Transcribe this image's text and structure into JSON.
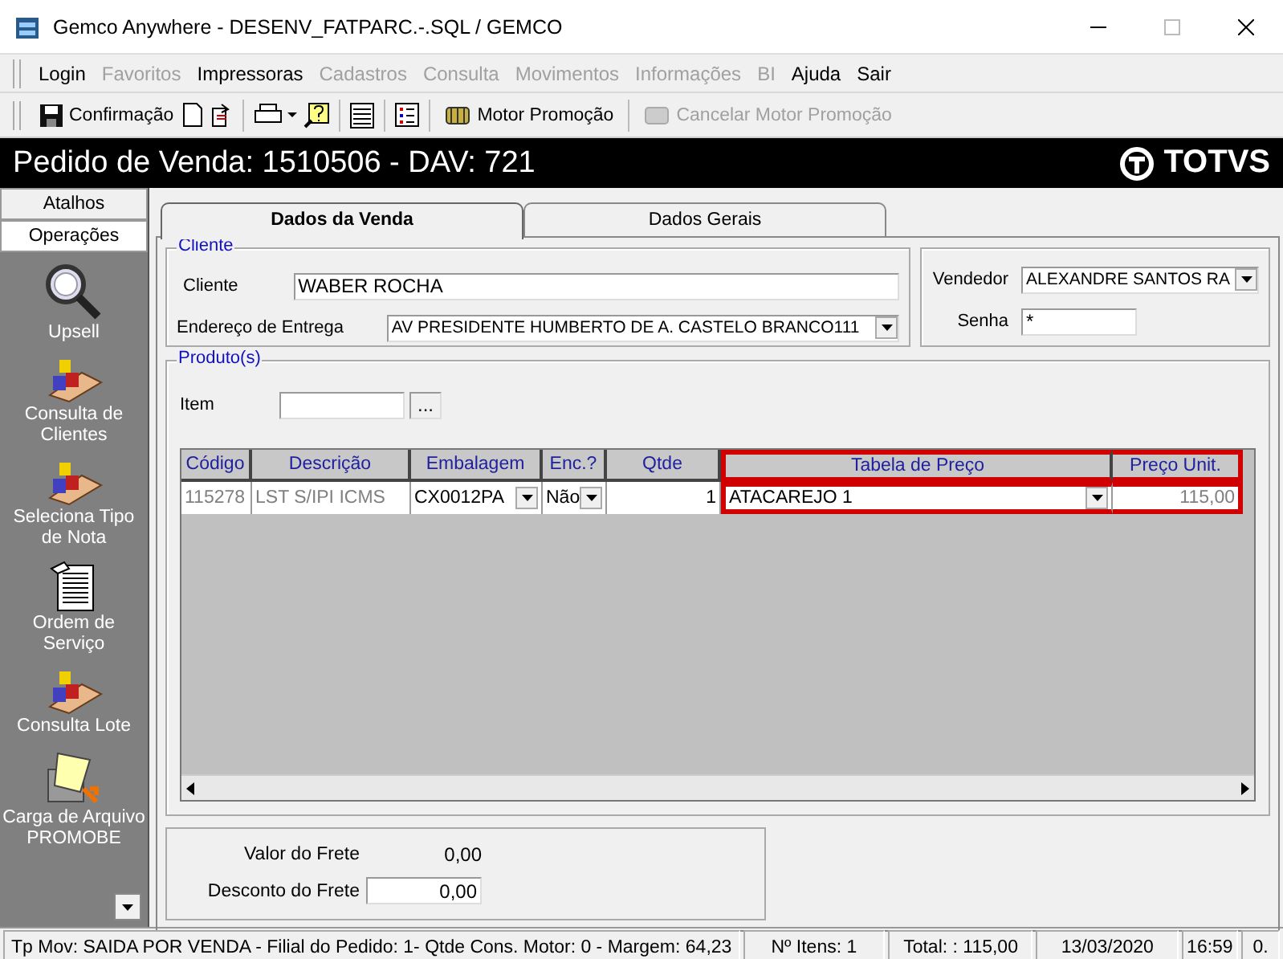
{
  "window": {
    "title": "Gemco Anywhere - DESENV_FATPARC.-.SQL / GEMCO"
  },
  "menu": [
    {
      "label": "Login",
      "disabled": false
    },
    {
      "label": "Favoritos",
      "disabled": true
    },
    {
      "label": "Impressoras",
      "disabled": false
    },
    {
      "label": "Cadastros",
      "disabled": true
    },
    {
      "label": "Consulta",
      "disabled": true
    },
    {
      "label": "Movimentos",
      "disabled": true
    },
    {
      "label": "Informações",
      "disabled": true
    },
    {
      "label": "BI",
      "disabled": true
    },
    {
      "label": "Ajuda",
      "disabled": false
    },
    {
      "label": "Sair",
      "disabled": false
    }
  ],
  "toolbar": [
    {
      "label": "Confirmação",
      "disabled": false
    },
    {
      "label": "Motor Promoção",
      "disabled": false
    },
    {
      "label": "Cancelar Motor Promoção",
      "disabled": true
    }
  ],
  "header": {
    "title": "Pedido de Venda: 1510506  - DAV: 721",
    "logo": "TOTVS"
  },
  "sidebar": {
    "sections": [
      {
        "label": "Atalhos",
        "selected": false
      },
      {
        "label": "Operações",
        "selected": true
      }
    ],
    "items": [
      {
        "label": "Upsell",
        "kind": "magnifier"
      },
      {
        "label": "Consulta de Clientes",
        "kind": "blocks"
      },
      {
        "label": "Seleciona Tipo de Nota",
        "kind": "blocks"
      },
      {
        "label": "Ordem de Serviço",
        "kind": "document"
      },
      {
        "label": "Consulta Lote",
        "kind": "blocks"
      },
      {
        "label": "Carga de Arquivo PROMOBE",
        "kind": "printer"
      }
    ]
  },
  "tabs": [
    {
      "label": "Dados da Venda",
      "selected": true
    },
    {
      "label": "Dados Gerais",
      "selected": false
    }
  ],
  "cliente": {
    "title": "Cliente",
    "cliente_label": "Cliente",
    "cliente_value": "WABER ROCHA",
    "endereco_label": "Endereço de Entrega",
    "endereco_value": "AV PRESIDENTE HUMBERTO DE A. CASTELO BRANCO111"
  },
  "vendedor": {
    "vendedor_label": "Vendedor",
    "vendedor_value": "ALEXANDRE SANTOS RA",
    "senha_label": "Senha",
    "senha_value": "*"
  },
  "produtos": {
    "title": "Produto(s)",
    "item_label": "Item",
    "browse": "...",
    "columns": [
      {
        "label": "Código",
        "highlighted": false
      },
      {
        "label": "Descrição",
        "highlighted": false
      },
      {
        "label": "Embalagem",
        "highlighted": false
      },
      {
        "label": "Enc.?",
        "highlighted": false
      },
      {
        "label": "Qtde",
        "highlighted": false
      },
      {
        "label": "Tabela de Preço",
        "highlighted": true
      },
      {
        "label": "Preço Unit.",
        "highlighted": true
      }
    ],
    "rows": [
      [
        "115278",
        "LST S/IPI  ICMS",
        "CX0012PA",
        "Não",
        "1",
        "ATACAREJO 1",
        "115,00"
      ]
    ]
  },
  "frete": {
    "valor_label": "Valor do Frete",
    "valor": "0,00",
    "desconto_label": "Desconto do Frete",
    "desconto": "0,00"
  },
  "status_bar": [
    "Tp Mov: SAIDA POR VENDA - Filial do Pedido: 1-  Qtde Cons. Motor: 0  - Margem: 64,23",
    "Nº Itens: 1",
    "Total: : 115,00",
    "13/03/2020",
    "16:59",
    "0."
  ]
}
